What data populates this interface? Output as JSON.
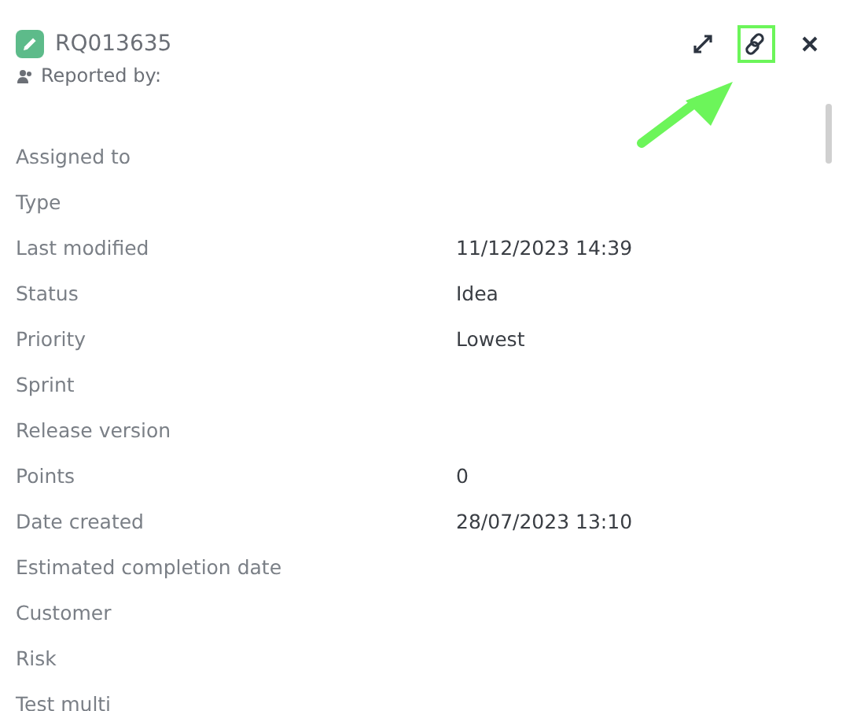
{
  "header": {
    "id": "RQ013635",
    "reported_by": "Reported by:"
  },
  "fields": [
    {
      "label": "Assigned to"
    },
    {
      "label": "Type"
    },
    {
      "label": "Last modified",
      "value": "11/12/2023 14:39"
    },
    {
      "label": "Status",
      "value": "Idea"
    },
    {
      "label": "Priority",
      "value": "Lowest"
    },
    {
      "label": "Sprint"
    },
    {
      "label": "Release version"
    },
    {
      "label": "Points",
      "value": "0"
    },
    {
      "label": "Date created",
      "value": "28/07/2023 13:10"
    },
    {
      "label": "Estimated completion date"
    },
    {
      "label": "Customer"
    },
    {
      "label": "Risk"
    },
    {
      "label": "Test multi"
    }
  ],
  "link_highlighted": true
}
